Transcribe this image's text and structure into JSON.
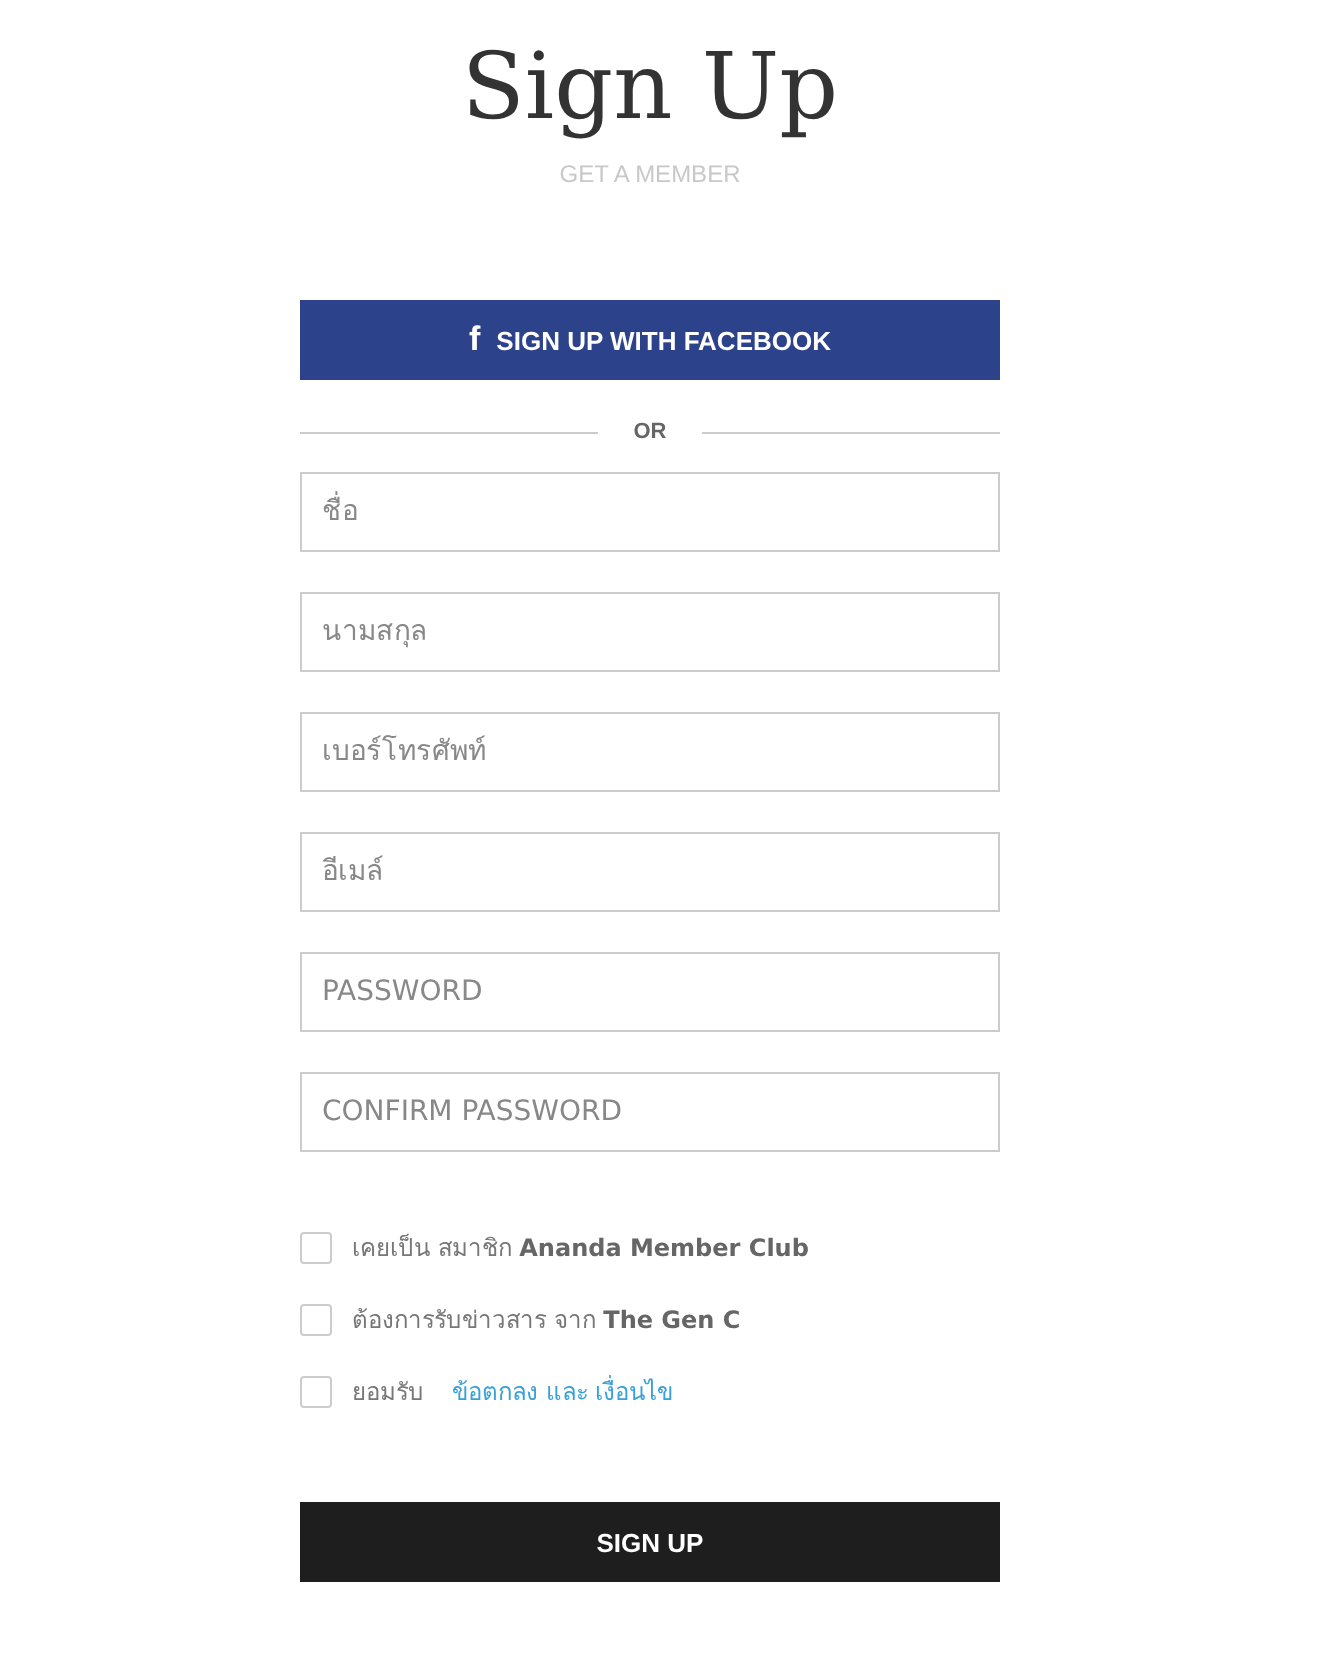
{
  "title": "Sign Up",
  "subtitle": "GET A MEMBER",
  "facebook_button": {
    "icon": "f",
    "label": "SIGN UP WITH FACEBOOK"
  },
  "divider": "OR",
  "fields": [
    {
      "placeholder": "ชื่อ"
    },
    {
      "placeholder": "นามสกุล"
    },
    {
      "placeholder": "เบอร์โทรศัพท์"
    },
    {
      "placeholder": "อีเมล์"
    },
    {
      "placeholder": "PASSWORD"
    },
    {
      "placeholder": "CONFIRM PASSWORD"
    }
  ],
  "options": [
    {
      "label": "เคยเป็น สมาชิก **Ananda Member Club**",
      "checked": false
    },
    {
      "label": "ต้องการรับข่าวสาร จาก **The Gen C**",
      "checked": false
    },
    {
      "label": "ยอมรับ",
      "link": "ข้อตกลง และ เงื่อนไข",
      "checked": false
    }
  ],
  "submit_button": "SIGN UP"
}
